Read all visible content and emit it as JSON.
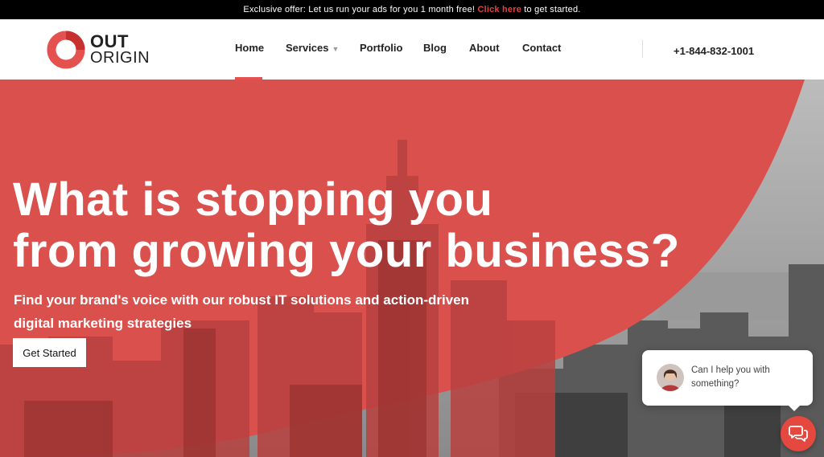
{
  "promo": {
    "before": "Exclusive offer: Let us run your ads for you 1 month free! ",
    "link": "Click here",
    "after": " to get started."
  },
  "brand": {
    "line1": "OUT",
    "line2": "ORIGIN",
    "accent": "#e5514f"
  },
  "nav": {
    "items": [
      {
        "label": "Home",
        "active": true
      },
      {
        "label": "Services",
        "has_dropdown": true
      },
      {
        "label": "Portfolio"
      },
      {
        "label": "Blog"
      },
      {
        "label": "About"
      },
      {
        "label": "Contact"
      }
    ],
    "phone": "+1-844-832-1001"
  },
  "hero": {
    "title_line1": "What is stopping you",
    "title_line2": "from growing your business?",
    "subtitle_line1": "Find your brand's voice with our robust IT solutions and action-driven",
    "subtitle_line2": "digital marketing strategies",
    "cta_label": "Get Started",
    "overlay_color": "#d9504d"
  },
  "chat": {
    "message_line1": "Can I help you with",
    "message_line2": "something?",
    "button_icon": "chat-icon",
    "button_color": "#e4483f"
  }
}
